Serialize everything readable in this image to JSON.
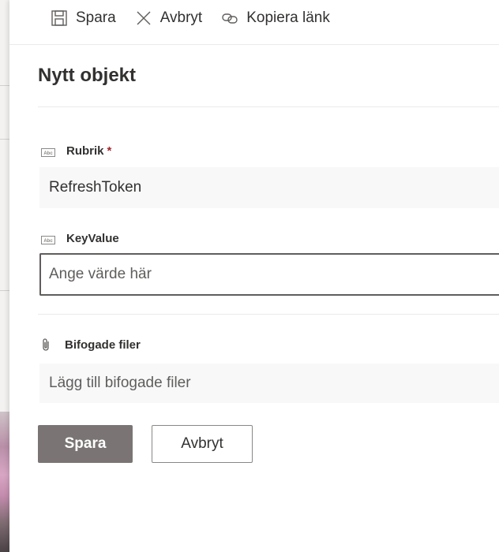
{
  "toolbar": {
    "save_label": "Spara",
    "cancel_label": "Avbryt",
    "copy_link_label": "Kopiera länk"
  },
  "form": {
    "title": "Nytt objekt",
    "fields": [
      {
        "label": "Rubrik",
        "required_mark": "*",
        "value": "RefreshToken",
        "icon": "text-field-icon"
      },
      {
        "label": "KeyValue",
        "placeholder": "Ange värde här",
        "value": "",
        "icon": "text-field-icon"
      }
    ],
    "attachments": {
      "label": "Bifogade filer",
      "add_label": "Lägg till bifogade filer",
      "icon": "paperclip-icon"
    }
  },
  "actions": {
    "primary_label": "Spara",
    "secondary_label": "Avbryt"
  },
  "colors": {
    "primary_button": "#7a7574",
    "required": "#a4262c",
    "text": "#323130"
  }
}
